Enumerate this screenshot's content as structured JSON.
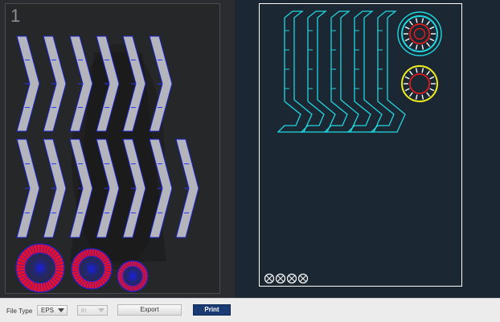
{
  "preview": {
    "page_number": "1"
  },
  "cad_layout": {
    "chevron_count": 5,
    "gear_count": 2,
    "corner_marker_count": 4
  },
  "toolbar": {
    "file_type_label": "File Type",
    "file_type_value": "EPS",
    "units_value": "in",
    "export_label": "Export",
    "print_label": "Print"
  },
  "colors": {
    "parts_gray": "#b4b4bc",
    "parts_outline": "#1c22c8",
    "wheel_red": "#e8102a",
    "cad_cyan": "#20d7e0",
    "cad_yellow": "#ecec20",
    "cad_red": "#ee1a1a",
    "cad_bg": "#1b2733",
    "print_button": "#193a73"
  }
}
